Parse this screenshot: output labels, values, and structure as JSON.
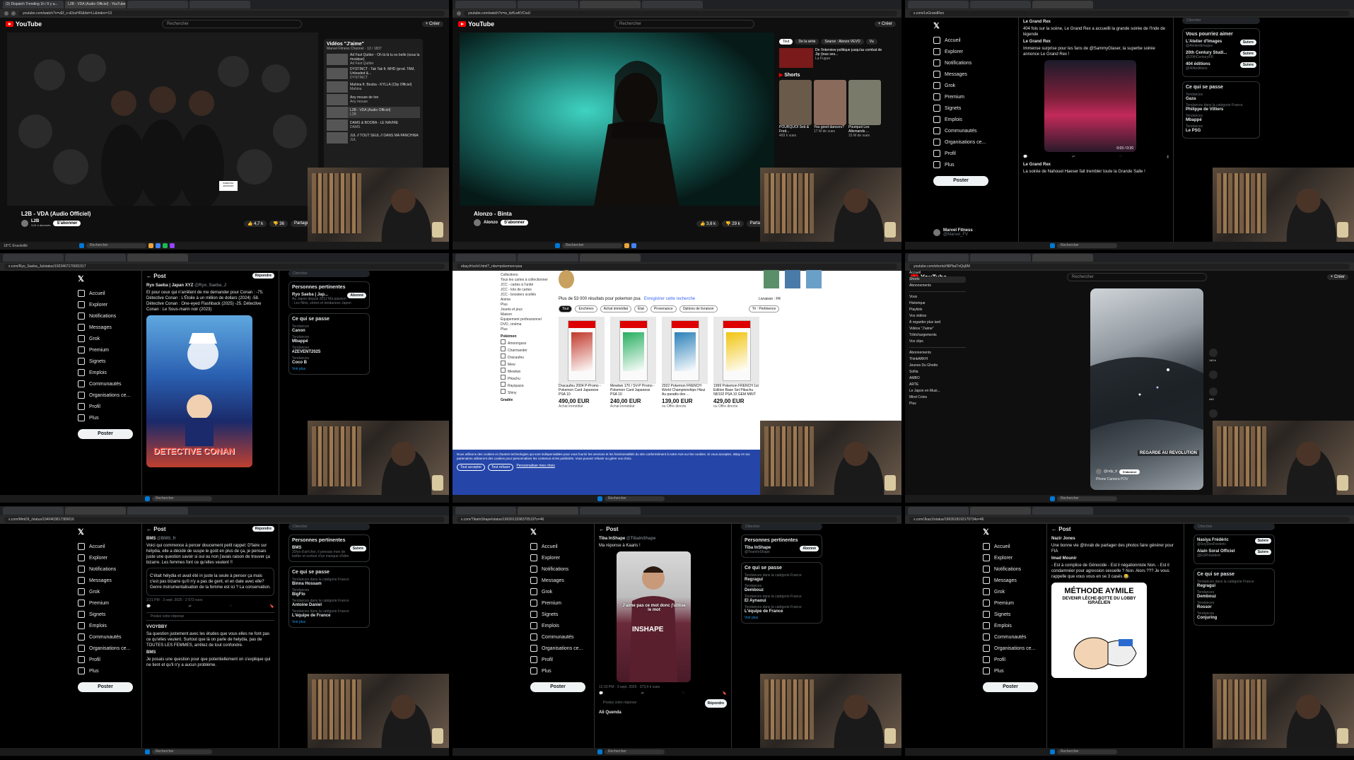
{
  "common": {
    "taskbar_search": "Rechercher",
    "weather": "18°C Ensoleillé"
  },
  "t1": {
    "tabs": [
      "(3) Dispatch Trending 1h / Il y a...",
      "L2B - VDA (Audio Officiel) - YouTube",
      "",
      "",
      "",
      ""
    ],
    "url": "youtube.com/watch?v=vEf_x-d2zuHlS&list=LL&index=13",
    "search_placeholder": "Rechercher",
    "create": "+ Créer",
    "video_title": "L2B - VDA (Audio Officiel)",
    "channel": "L2B",
    "subscribers": "3,61 k abonnés",
    "subscribe": "S'abonner",
    "likes": "4,7 k",
    "dislikes": "36",
    "share": "Partager",
    "parental": "PARENTAL ADVISORY",
    "playlist_title": "Vidéos \"J'aime\"",
    "playlist_owner": "Marvel Fitness Channel",
    "playlist_count": "13 / 1837",
    "playlist_items": [
      {
        "t": "Ad Fast Quitter - Oh là là tu es belle (sous la musique)",
        "c": "Ad Fast Quitter"
      },
      {
        "t": "DYSTINCT - Tak Tak ft. MHD (prod. TAM, Unleaded &...",
        "c": "DYSTINCT"
      },
      {
        "t": "Mahina ft. Booba - KYLLA (Clip Officiel)",
        "c": "Mahina"
      },
      {
        "t": "Any mouse de ton",
        "c": "Any mouse"
      },
      {
        "t": "L2B - VDA (Audio Officiel)",
        "c": "L2B"
      },
      {
        "t": "DAMS & BOOBA - LE NAVIRE",
        "c": "DAMS"
      },
      {
        "t": "JUL // TOUT SEUL // DANS MA PANCHINA",
        "c": "JUL"
      }
    ]
  },
  "t2": {
    "url": "youtube.com/watch?v=w_dzfLwKVCwU",
    "video_title": "Alonzo - Binta",
    "channel": "Alonzo",
    "subscribe": "S'abonner",
    "likes": "3,6 k",
    "dislikes": "29 k",
    "share": "Partager",
    "chips": [
      "Tout",
      "De la série",
      "Source : Alonzo VEVO",
      "Vu"
    ],
    "rec_title": "De l'interview politique jusqu'au combat de Jip (tous ses...",
    "rec_channel": "La Fugue",
    "shorts": "Shorts",
    "short_items": [
      {
        "t": "POURQUOI Seb & Fred...",
        "v": "493 k vues"
      },
      {
        "t": "You good dancers?",
        "v": "17 M de vues"
      },
      {
        "t": "Pourquoi Les Allemands ...",
        "v": "15 M de vues"
      }
    ]
  },
  "t3": {
    "url": "x.com/LeGrandRex",
    "nav": [
      "Accueil",
      "Explorer",
      "Notifications",
      "Messages",
      "Grok",
      "Premium",
      "Signets",
      "Emplois",
      "Communautés",
      "Organisations ce...",
      "Profil",
      "Plus"
    ],
    "post_btn": "Poster",
    "me_name": "Marvel Fitness",
    "me_handle": "@Marvel_FV",
    "account": "Le Grand Rex",
    "tweet1": "404 fois sur la scène, Le Grand Rex a accueilli la grande soirée de l'Inde de légende",
    "tweet2": "Immense surprise pour les fans de @SammyGlaser, la superbe soirée annonce Le Grand Rex !",
    "video_time": "0:03 / 0:20",
    "tweet3": "La soirée de Nahouel Haeser fait trembler toute la Grande Salle !",
    "search": "Chercher",
    "suggest_h": "Vous pourriez aimer",
    "suggest": [
      {
        "n": "L'Atelier d'Images",
        "h": "@Atelierdimages"
      },
      {
        "n": "20th Century Studi...",
        "h": "@20thCenturyFR"
      },
      {
        "n": "404 éditions",
        "h": "@404editions"
      }
    ],
    "follow": "Suivre",
    "trend_h": "Ce qui se passe",
    "trends": [
      {
        "s": "Tendances",
        "t": "Gaza"
      },
      {
        "s": "Tendances dans la catégorie France",
        "t": "Philippe de Villiers"
      },
      {
        "s": "Tendances",
        "t": "Mbappé"
      },
      {
        "s": "Tendances",
        "t": "Le PSG"
      }
    ]
  },
  "t4": {
    "url": "x.com/Ryo_Saeba_Ja/status/1923467179001917",
    "head": "Post",
    "reply_btn": "Répondre",
    "account": "Ryo Saeba | Japan XYZ",
    "handle": "@Ryo_Saeba_J",
    "tweet": "Et pour ceux qui n'arrêtent de me demander pour Conan : -75. Détective Conan : L'Étoile à un million de dollars (2024) -58. Détective Conan : One-eyed Flashback (2025) -25. Détective Conan : Le Sous-marin noir (2023)",
    "poster_title": "DETECTIVE CONAN",
    "related_h": "Personnes pertinentes",
    "related_name": "Ryo Saeba | Jap...",
    "related_bio": "Au Japon depuis 2012 Ma passion : Les films, séries et tendances Japon",
    "subscribed": "Abonné",
    "trend_h": "Ce qui se passe",
    "trends": [
      {
        "s": "Tendances",
        "t": "Canon"
      },
      {
        "s": "Tendances",
        "t": "Mbappé"
      },
      {
        "s": "Tendances",
        "t": "#ZEVENT2025"
      },
      {
        "s": "Tendances",
        "t": "Coco B"
      }
    ],
    "see_more": "Voir plus"
  },
  "t5": {
    "url": "ebay.fr/sch/i.html?_nkw=pokemon+psa",
    "results": "Plus de 53 000 résultats pour pokemon psa",
    "save": "Enregistrer cette recherche",
    "delivery": "Livraison : FR",
    "filters": [
      "Tout",
      "Enchères",
      "Achat immédiat",
      "État",
      "Provenance",
      "Options de livraison"
    ],
    "sort": "Tri : Pertinence",
    "sidebar": [
      "Collections",
      "Tous les cartes à collectionner",
      "JCC - cartes à l'unité",
      "JCC - lots de cartes",
      "JCC - boosters scellés",
      "Anime",
      "Plus",
      "Jouets et jeux",
      "Maison",
      "Équipement professionnel",
      "DVD, cinéma",
      "Plus"
    ],
    "pokemon_h": "Pokémon",
    "pokemon": [
      "Amoonguss",
      "Charmander",
      "Dracaufeu",
      "Mew",
      "Mewtwo",
      "Pikachu",
      "Rayquaza",
      "Shiny"
    ],
    "char_h": "Personnage",
    "graded_h": "Gradée",
    "cards": [
      {
        "t": "Dracaufeu 2004 P-Promo - Pokemon Card Japanese PSA 10",
        "p": "490,00 EUR",
        "m": "Achat immédiat"
      },
      {
        "t": "Mewtwo 170 / SV-P Promo - Pokemon Card Japanese PSA 10",
        "p": "240,00 EUR",
        "m": "Achat immédiat"
      },
      {
        "t": "2022 Pokemon FRENCH World Championships Hisui Au paradis des ...",
        "p": "139,00 EUR",
        "m": "ou Offre directe"
      },
      {
        "t": "1999 Pokemon FRENCH 1st Edition Base Set Pikachu 58/102 PSA 10 GEM MINT",
        "p": "429,00 EUR",
        "m": "ou Offre directe"
      }
    ],
    "cookie_text": "Nous utilisons des cookies et d'autres technologies qui sont indispensables pour vous fournir les services et les fonctionnalités du site conformément à notre Avis sur les cookies. Si vous acceptez, eBay et nos partenaires utiliseront des cookies pour personnaliser les contenus et les publicités. Vous pouvez refuser ou gérer vos choix.",
    "accept": "Tout accepter",
    "refuse": "Tout refuser",
    "customize": "Personnaliser mes choix"
  },
  "t6": {
    "url": "youtube.com/shorts/rNlPbaTnQq9M",
    "side": [
      "Accueil",
      "Shorts",
      "Abonnements",
      "",
      "Vous",
      "Historique",
      "Playlists",
      "Vos vidéos",
      "À regarder plus tard",
      "Vidéos \"J'aime\"",
      "Téléchargements",
      "Vos clips",
      "",
      "Abonnements",
      "ThinkARKH",
      "Jeunes Du Ghetto",
      "Sofiia",
      "AMBO",
      "ARTE",
      "Le Japon en Musi...",
      "Mind Coins",
      "Plus"
    ],
    "channel": "@ndp_tt",
    "subscribe": "S'abonner",
    "caption": "Phone Camera POV",
    "likes": "140 k",
    "comments": "440",
    "share": "Partager",
    "overlay": "REGARDE AU REVOLUTION"
  },
  "t7": {
    "url": "x.com/MmD9_/status/1940403817389016",
    "head": "Post",
    "reply_btn": "Répondre",
    "account": "BMS",
    "handle": "@BMS_fr",
    "tweet": "Voici qui commence à percer doucement petit rappel: D'faire sur hélydia, elle a décidé de suspe le goût en plus de ça, je pensais juste une question savoir si oui ou non j'avais raison de trouver ça bizarre. Les femmes font ce qu'elles veulent !!",
    "quote": "C'était hélydia et avait été in juste la seule à penser ça mais c'est pas bizarre qu'il n'y a pas de gent, et en date avec elle? Genre instrumentalisation de la femme est ici ? La conservation.",
    "time": "3:21 PM · 3 sept. 2025 · 2 573 vues",
    "reply_placeholder": "Postez votre réponse",
    "reply2_user": "VVOYBBY",
    "reply2": "Sa question justement avec les études que vous elles ne font pas ce qu'elles veulent. Surtout que là on parle de helydia, pas de TOUTES LES FEMMES, arrêtez de tout confondre.",
    "reply3_user": "BMS",
    "reply3": "Je posais une question pour que potentiellement on s'explique qui ne tient et qu'il n'y a aucun problème.",
    "related_h": "Personnes pertinentes",
    "related_name": "BMS",
    "related_bio": "20/yo d'art'cher, il pensais mon de twitter et surtout d'un manque d'idée",
    "follow": "Suivre",
    "trend_h": "Ce qui se passe",
    "trends": [
      {
        "s": "Tendances dans la catégorie France",
        "t": "Binna Hossam"
      },
      {
        "s": "Tendances",
        "t": "BigFlo"
      },
      {
        "s": "Tendances dans la catégorie France",
        "t": "Antoine Daniel"
      },
      {
        "s": "Tendances dans la catégorie France",
        "t": "L'équipe de France"
      }
    ],
    "see_more": "Voir plus"
  },
  "t8": {
    "url": "x.com/TibaInShape/status/1963913298370519?s=46",
    "head": "Post",
    "account": "Tiba InShape",
    "handle": "@TibaInShape",
    "tweet": "Ma réponse à Kaaris !",
    "video_caption": "J'aime pas ce mot donc j'utilise le mot",
    "shirt": "INSHAPE",
    "time": "12:33 PM · 3 sept. 2025 · 373,4 k vues",
    "reply_placeholder": "Postez votre réponse",
    "reply_btn": "Répondre",
    "related_h": "Personnes pertinentes",
    "related_name": "Tiba InShape",
    "related_bio": "@TeamInShape",
    "subscribed": "Abonné",
    "trend_h": "Ce qui se passe",
    "trends": [
      {
        "s": "Tendances dans la catégorie France",
        "t": "Regragui"
      },
      {
        "s": "Tendances",
        "t": "Dembouz"
      },
      {
        "s": "Tendances dans la catégorie France",
        "t": "El Aynaoui"
      },
      {
        "s": "Tendances dans la catégorie France",
        "t": "L'équipe de France"
      }
    ],
    "see_more": "Voir plus",
    "reply_user": "Ali Quenda"
  },
  "t9": {
    "url": "x.com/Jkaz1/status/1963918193170734s=46",
    "head": "Post",
    "reply_user": "Nazir Jones",
    "reply": "Une bonne vie @Inrab de partager des photos faire générer pour FIA",
    "main_user": "Imad Mounir",
    "main_text": "- Est à complice de Génocide - Est il négationniste Non. - Est il condamnéer pour agression sexuelle ? Non. Alors ??? Je vous rappelle que vous vous en se 3 casés 😂.",
    "image_title": "MÉTHODE AYMILE",
    "image_sub": "DEVENIR LÈCHE-BOTTE DU LOBBY ISRAÉLIEN",
    "related_h": "",
    "suggest": [
      {
        "n": "Nasiya Frédéric",
        "h": "@SoyDesFrederic"
      },
      {
        "n": "Alain Soral Officiel",
        "h": "@ESPrésident"
      }
    ],
    "follow": "Suivre",
    "trend_h": "Ce qui se passe",
    "trends": [
      {
        "s": "Tendances dans la catégorie France",
        "t": "Regragui"
      },
      {
        "s": "Tendances",
        "t": "Dembouz"
      },
      {
        "s": "Tendances",
        "t": "Rossor"
      },
      {
        "s": "Tendances",
        "t": "Conjuring"
      }
    ]
  }
}
